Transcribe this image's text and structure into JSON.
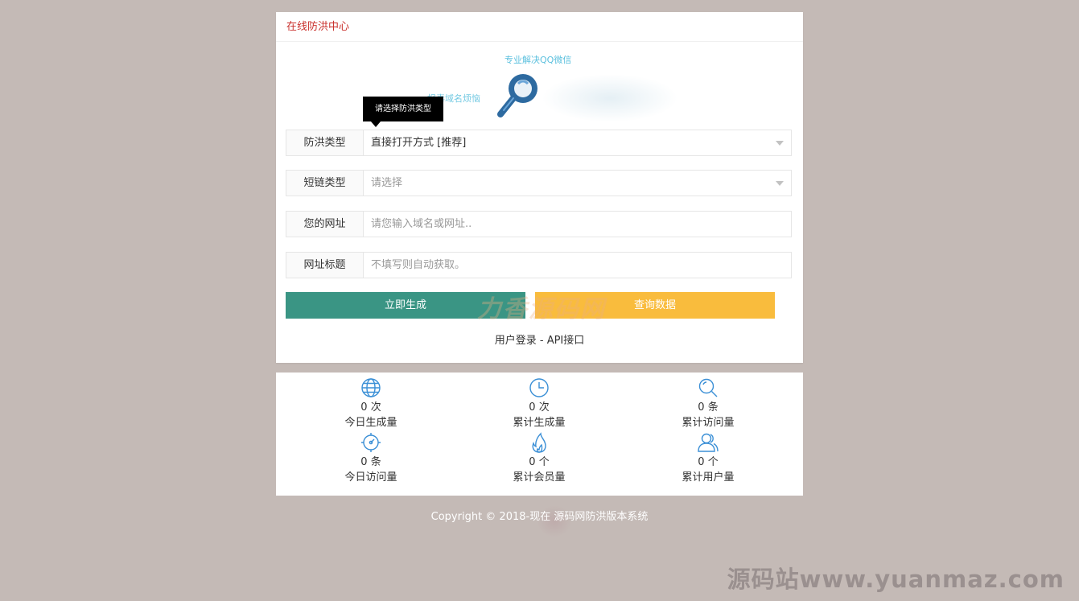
{
  "panel": {
    "title": "在线防洪中心",
    "banner_line1": "专业解决QQ微信",
    "banner_line2": "报毒域名烦恼",
    "tooltip": "请选择防洪类型"
  },
  "form": {
    "rows": [
      {
        "label": "防洪类型",
        "value": "直接打开方式 [推荐]",
        "type": "select"
      },
      {
        "label": "短链类型",
        "placeholder": "请选择",
        "type": "select"
      },
      {
        "label": "您的网址",
        "placeholder": "请您输入域名或网址..",
        "type": "input"
      },
      {
        "label": "网址标题",
        "placeholder": "不填写则自动获取。",
        "type": "input"
      }
    ],
    "generate_label": "立即生成",
    "query_label": "查询数据",
    "watermark": "力香源码网",
    "login_link": "用户登录",
    "separator": " - ",
    "api_link": "API接口"
  },
  "stats": [
    {
      "icon": "globe-icon",
      "value": "0 次",
      "label": "今日生成量"
    },
    {
      "icon": "clock-icon",
      "value": "0 次",
      "label": "累计生成量"
    },
    {
      "icon": "search-icon",
      "value": "0 条",
      "label": "累计访问量"
    },
    {
      "icon": "gear-icon",
      "value": "0 条",
      "label": "今日访问量"
    },
    {
      "icon": "fire-icon",
      "value": "0 个",
      "label": "累计会员量"
    },
    {
      "icon": "users-icon",
      "value": "0 个",
      "label": "累计用户量"
    }
  ],
  "footer": {
    "text": "Copyright © 2018-现在        源码网防洪版本系统"
  },
  "corner_watermark": "源码站www.yuanmaz.com",
  "colors": {
    "accent_red": "#c9302c",
    "green": "#3a9584",
    "yellow": "#f9bc3d",
    "icon_blue": "#3a8fd6"
  }
}
